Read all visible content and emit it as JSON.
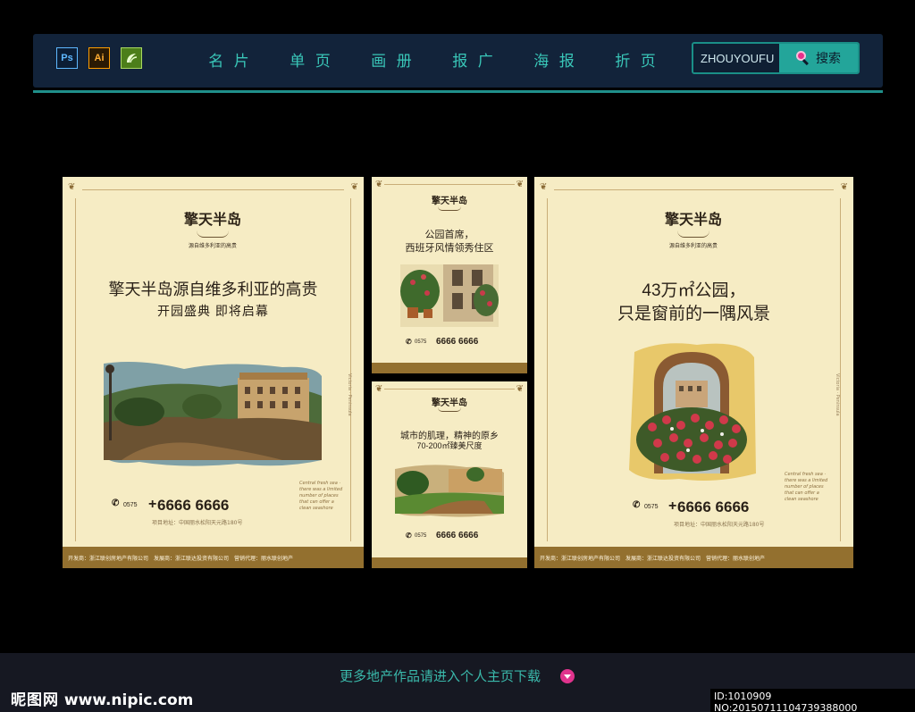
{
  "toolbar": {
    "apps": [
      {
        "label": "Ps",
        "icon": "photoshop-icon"
      },
      {
        "label": "Ai",
        "icon": "illustrator-icon"
      },
      {
        "label": "",
        "icon": "coreldraw-icon"
      }
    ],
    "nav": [
      "名 片",
      "单 页",
      "画 册",
      "报 广",
      "海 报",
      "折 页"
    ],
    "search": {
      "value": "ZHOUYOUFU",
      "button": "搜索"
    },
    "colors": {
      "bar": "#12233a",
      "accent": "#1f8f8a",
      "nav_text": "#39c6b8"
    }
  },
  "posters": {
    "left": {
      "brand": "擎天半岛",
      "tagline": "源自维多利亚的高贵",
      "headline": "擎天半岛源自维多利亚的高贵",
      "subhead": "开园盛典 即将启幕",
      "area_code": "0575",
      "phone": "6666 6666",
      "address": "项目地址：中国丽水松阳天元路180号",
      "footer": "开发商：浙江联创房地产有限公司　发展商：浙江联达投资有限公司　营销代理：丽水联创地产"
    },
    "top_mid": {
      "brand": "擎天半岛",
      "headline_1": "公园首席，",
      "headline_2": "西班牙风情领秀住区",
      "area_code": "0575",
      "phone": "6666 6666"
    },
    "bottom_mid": {
      "brand": "擎天半岛",
      "headline_1": "城市的肌理，精神的原乡",
      "headline_2": "70-200㎡臻美尺度",
      "area_code": "0575",
      "phone": "6666 6666"
    },
    "right": {
      "brand": "擎天半岛",
      "tagline": "源自维多利亚的高贵",
      "headline_1": "43万㎡公园，",
      "headline_2": "只是窗前的一隅风景",
      "area_code": "0575",
      "phone": "6666 6666",
      "address": "项目地址：中国丽水松阳天元路180号",
      "footer": "开发商：浙江联创房地产有限公司　发展商：浙江联达投资有限公司　营销代理：丽水联创地产"
    }
  },
  "bottom": {
    "more": "更多地产作品请进入个人主页下载",
    "watermark_cn": "昵图网",
    "watermark_url": "www.nipic.com",
    "id_line": "ID:1010909 NO:20150711104739388000"
  }
}
